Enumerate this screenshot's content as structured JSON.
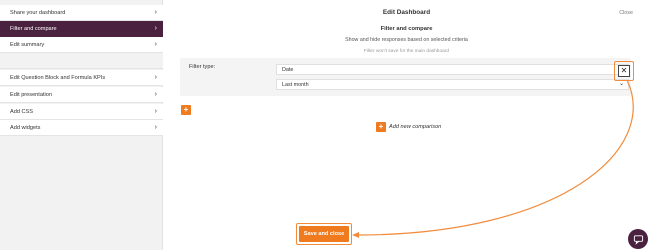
{
  "sidebar": {
    "items": [
      {
        "label": "Share your dashboard",
        "state": "normal"
      },
      {
        "label": "Filter and compare",
        "state": "active"
      },
      {
        "label": "Edit summary",
        "state": "normal"
      },
      {
        "label": "",
        "state": "disabled"
      },
      {
        "label": "Edit Question Block and Formula KPIs",
        "state": "normal"
      },
      {
        "label": "Edit presentation",
        "state": "normal"
      },
      {
        "label": "Add CSS",
        "state": "normal"
      },
      {
        "label": "Add widgets",
        "state": "normal"
      }
    ],
    "chevron": "›"
  },
  "dialog": {
    "title": "Edit Dashboard",
    "close_label": "Close",
    "section_title": "Filter and compare",
    "section_desc": "Show and hide responses based on selected criteria",
    "note": "Filter won't save for the main dashboard"
  },
  "filter": {
    "label": "Filter type:",
    "type_value": "Date",
    "period_value": "Last month",
    "remove_glyph": "✕",
    "caret": "⌄"
  },
  "actions": {
    "add_filter_glyph": "+",
    "add_comparison_glyph": "+",
    "add_comparison_label": "Add new comparison",
    "save_label": "Save and close"
  },
  "colors": {
    "accent": "#f07a1e",
    "sidebar_active": "#4a2240",
    "annotation": "#f28c3c"
  },
  "icons": {
    "chat": "chat-bubble-icon",
    "remove": "close-icon",
    "chevron": "chevron-right-icon"
  }
}
